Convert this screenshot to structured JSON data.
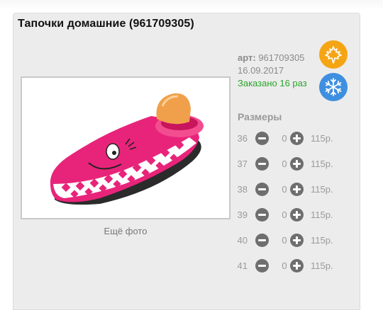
{
  "product": {
    "title": "Тапочки домашние (961709305)",
    "article_label": "арт:",
    "article_value": "961709305",
    "date": "16.09.2017",
    "ordered": "Заказано 16 раз",
    "more_photo": "Ещё фото",
    "season_icons": [
      "maple-leaf-icon",
      "snowflake-icon"
    ],
    "colors": {
      "summer": "#f5a514",
      "winter": "#3f8fe0",
      "ordered": "#2aa52a"
    }
  },
  "sizes": {
    "title": "Размеры",
    "rows": [
      {
        "size": "36",
        "qty": "0",
        "price": "115р."
      },
      {
        "size": "37",
        "qty": "0",
        "price": "115р."
      },
      {
        "size": "38",
        "qty": "0",
        "price": "115р."
      },
      {
        "size": "39",
        "qty": "0",
        "price": "115р."
      },
      {
        "size": "40",
        "qty": "0",
        "price": "115р."
      },
      {
        "size": "41",
        "qty": "0",
        "price": "115р."
      }
    ]
  }
}
